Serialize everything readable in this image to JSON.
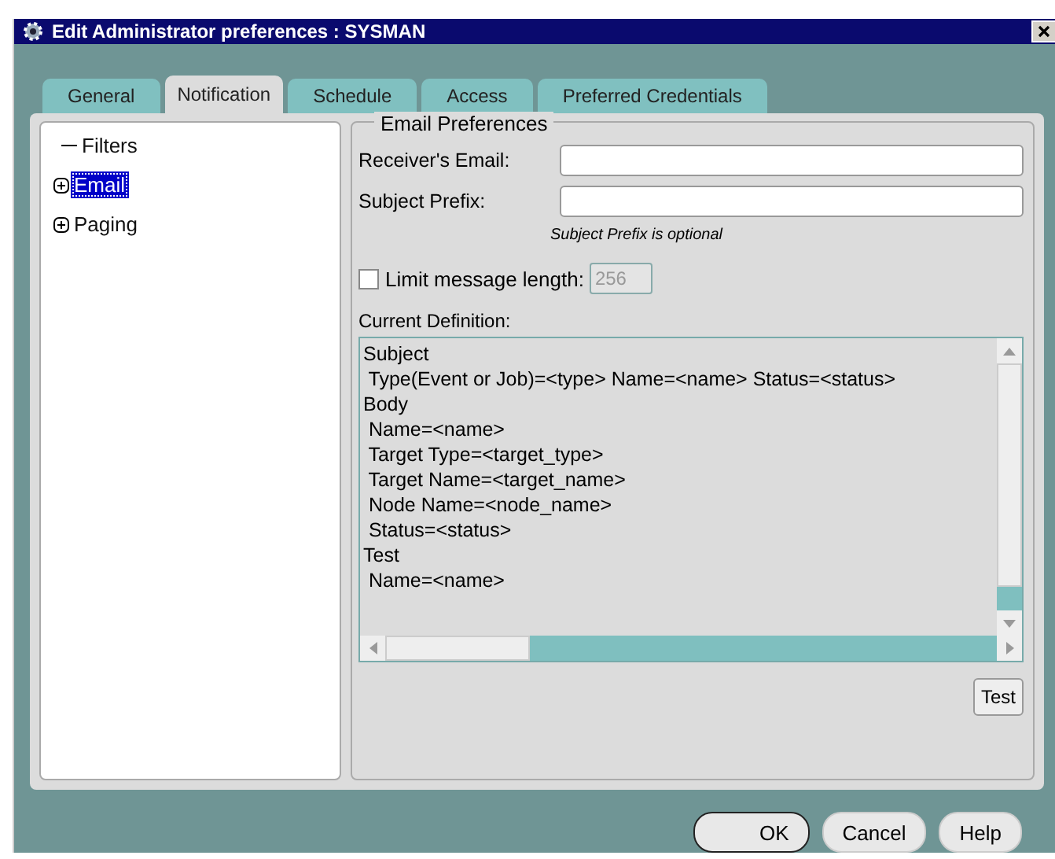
{
  "window": {
    "title": "Edit Administrator preferences : SYSMAN"
  },
  "tabs": [
    {
      "label": "General",
      "selected": false
    },
    {
      "label": "Notification",
      "selected": true
    },
    {
      "label": "Schedule",
      "selected": false
    },
    {
      "label": "Access",
      "selected": false
    },
    {
      "label": "Preferred Credentials",
      "selected": false
    }
  ],
  "tree": [
    {
      "label": "Filters",
      "expandable": false,
      "selected": false
    },
    {
      "label": "Email",
      "expandable": true,
      "selected": true
    },
    {
      "label": "Paging",
      "expandable": true,
      "selected": false
    }
  ],
  "email_preferences": {
    "title": "Email Preferences",
    "receivers_email_label": "Receiver's Email:",
    "subject_prefix_label": "Subject Prefix:",
    "subject_prefix_hint": "Subject Prefix is optional"
  },
  "limit": {
    "label": "Limit message length:",
    "checked": false,
    "value": "256",
    "disabled": true
  },
  "definition": {
    "label": "Current Definition:",
    "lines": [
      "Subject",
      " Type(Event or Job)=<type> Name=<name> Status=<status>",
      "Body",
      " Name=<name>",
      " Target Type=<target_type>",
      " Target Name=<target_name>",
      " Node Name=<node_name>",
      " Status=<status>",
      "Test",
      " Name=<name>"
    ]
  },
  "test_button": "Test",
  "buttons": [
    "OK",
    "Cancel",
    "Help"
  ]
}
